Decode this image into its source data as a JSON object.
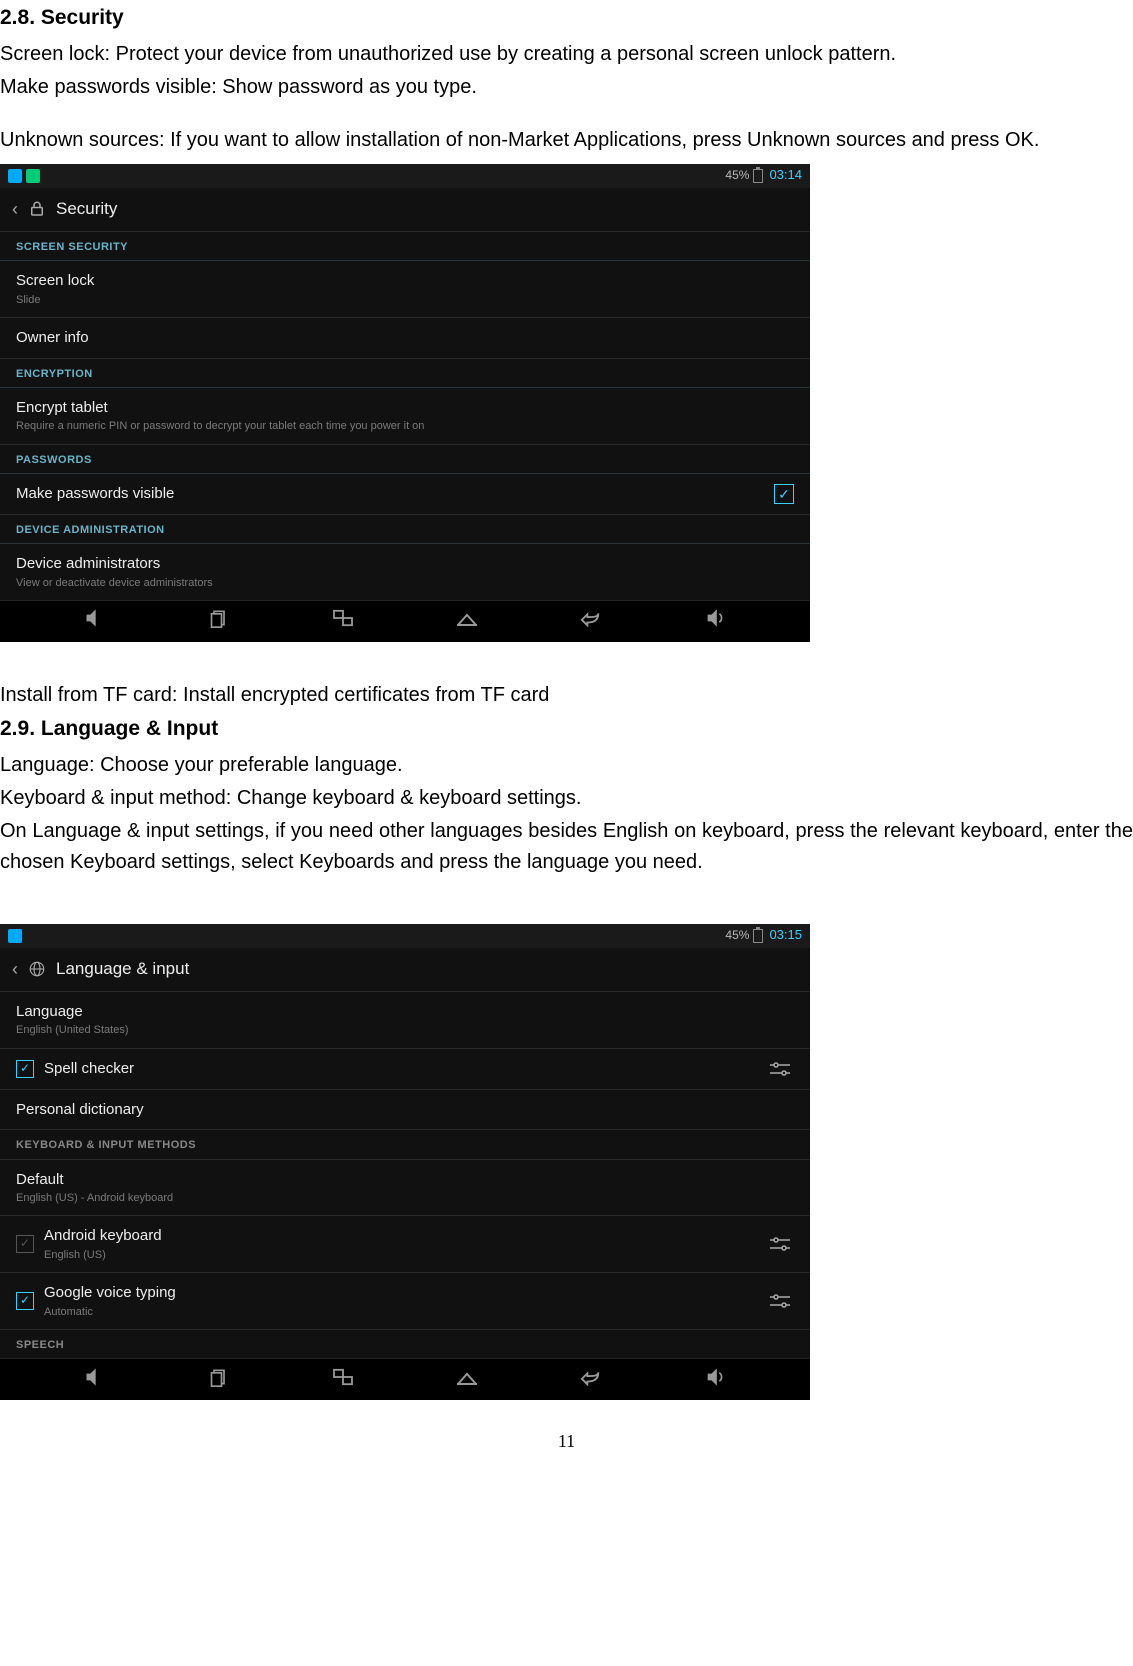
{
  "sec28": {
    "heading": "2.8. Security",
    "p1": "Screen lock: Protect your device from unauthorized use by creating a personal screen unlock pattern.",
    "p2": "Make passwords visible: Show password as you type.",
    "p3": "Unknown sources: If you want to allow installation of non-Market Applications, press Unknown sources and press OK.",
    "p4": "Install from TF card: Install encrypted certificates from TF card"
  },
  "sec29": {
    "heading": "2.9. Language & Input",
    "p1": "Language: Choose your preferable language.",
    "p2": "Keyboard & input method: Change keyboard & keyboard settings.",
    "p3": "On Language & input settings, if you need other languages besides English on keyboard, press the relevant keyboard, enter the chosen Keyboard settings, select Keyboards and press the language you need."
  },
  "shot1": {
    "battery": "45%",
    "time": "03:14",
    "title": "Security",
    "headers": {
      "screen_security": "SCREEN SECURITY",
      "encryption": "ENCRYPTION",
      "passwords": "PASSWORDS",
      "device_admin": "DEVICE ADMINISTRATION"
    },
    "rows": {
      "screen_lock": "Screen lock",
      "screen_lock_sub": "Slide",
      "owner_info": "Owner info",
      "encrypt": "Encrypt tablet",
      "encrypt_sub": "Require a numeric PIN or password to decrypt your tablet each time you power it on",
      "make_pw_visible": "Make passwords visible",
      "device_admins": "Device administrators",
      "device_admins_sub": "View or deactivate device administrators"
    }
  },
  "shot2": {
    "battery": "45%",
    "time": "03:15",
    "title": "Language & input",
    "headers": {
      "kb_input": "KEYBOARD & INPUT METHODS",
      "speech": "SPEECH"
    },
    "rows": {
      "language": "Language",
      "language_sub": "English (United States)",
      "spell": "Spell checker",
      "personal_dict": "Personal dictionary",
      "default": "Default",
      "default_sub": "English (US) - Android keyboard",
      "android_kb": "Android keyboard",
      "android_kb_sub": "English (US)",
      "google_voice": "Google voice typing",
      "google_voice_sub": "Automatic"
    }
  },
  "page_number": "11"
}
